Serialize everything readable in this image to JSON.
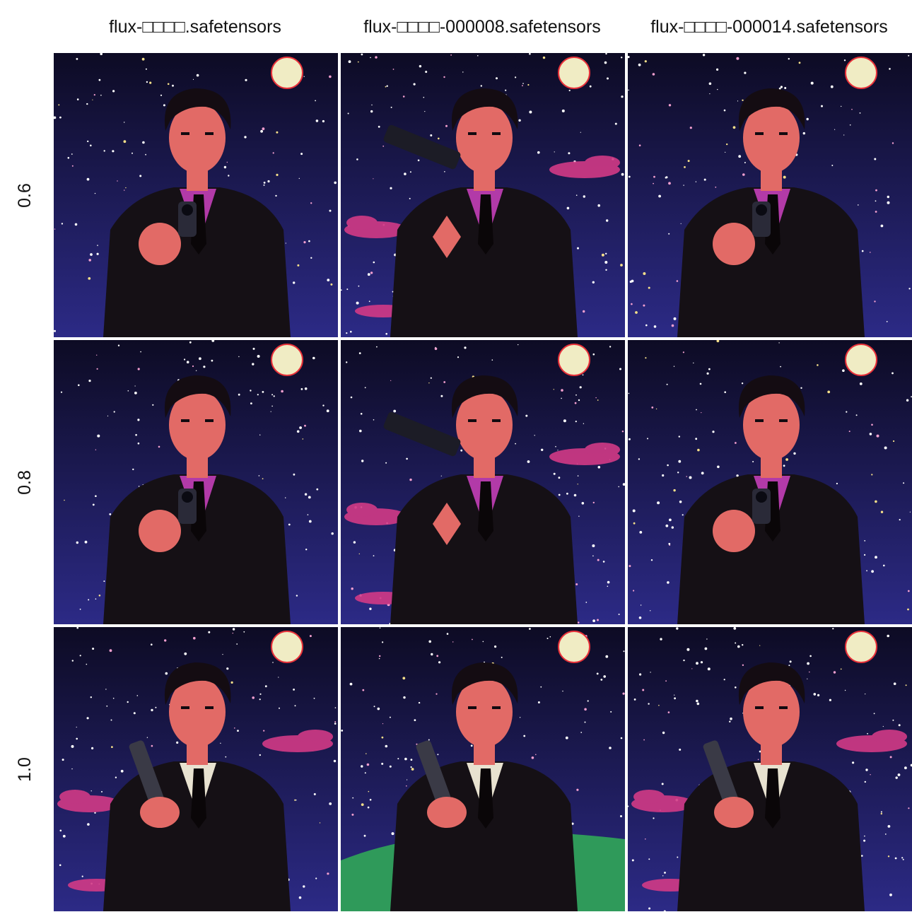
{
  "columns": [
    "flux-□□□□.safetensors",
    "flux-□□□□-000008.safetensors",
    "flux-□□□□-000014.safetensors"
  ],
  "rows": [
    "0.6",
    "0.8",
    "1.0"
  ],
  "palette": {
    "sky_top": "#0d0b24",
    "sky_bottom": "#2c2a86",
    "moon": "#f0ecc4",
    "moon_glow": "#e8323a",
    "suit": "#151015",
    "skin": "#e26a66",
    "shirt_purple": "#b23aa8",
    "cloud_pink": "#d23a86",
    "grass_green": "#2f9a5a"
  }
}
